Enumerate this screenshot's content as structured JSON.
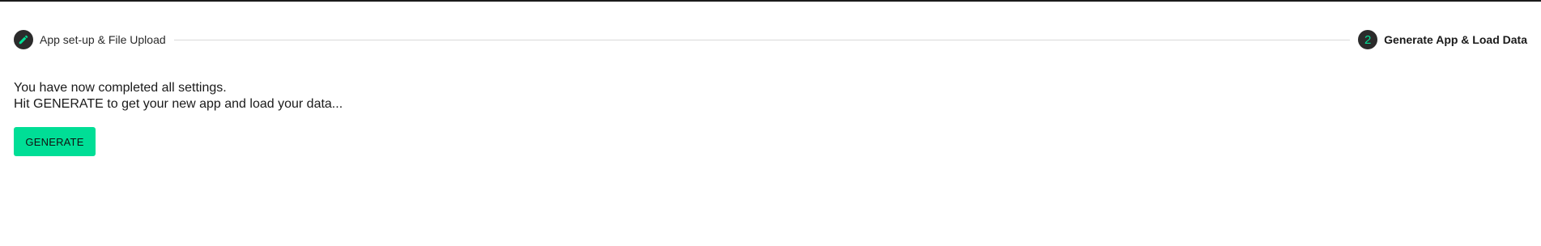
{
  "stepper": {
    "steps": [
      {
        "label": "App set-up & File Upload",
        "icon": "pencil-icon",
        "state": "completed"
      },
      {
        "label": "Generate App & Load Data",
        "number": "2",
        "state": "active"
      }
    ]
  },
  "main": {
    "message_line_1": "You have now completed all settings.",
    "message_line_2": "Hit GENERATE to get your new app and load your data...",
    "generate_button_label": "GENERATE"
  },
  "colors": {
    "accent": "#00de96",
    "step_circle": "#2b2b2b",
    "connector": "#d9d9d9"
  }
}
